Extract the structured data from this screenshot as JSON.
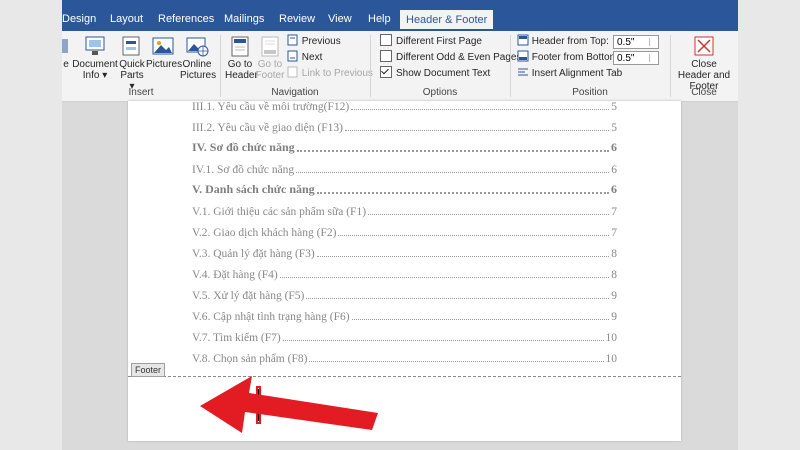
{
  "ribbon_tabs": [
    {
      "label": "Design"
    },
    {
      "label": "Layout"
    },
    {
      "label": "References"
    },
    {
      "label": "Mailings"
    },
    {
      "label": "Review"
    },
    {
      "label": "View"
    },
    {
      "label": "Help"
    },
    {
      "label": "Header & Footer"
    }
  ],
  "insert_group": {
    "label": "Insert",
    "buttons": [
      {
        "label": "e"
      },
      {
        "label": "Document Info ▾"
      },
      {
        "label": "Quick Parts ▾"
      },
      {
        "label": "Pictures"
      },
      {
        "label": "Online Pictures"
      }
    ]
  },
  "navigation_group": {
    "label": "Navigation",
    "go_to_header": "Go to Header",
    "go_to_footer": "Go to Footer",
    "previous": "Previous",
    "next": "Next",
    "link_to_previous": "Link to Previous"
  },
  "options_group": {
    "label": "Options",
    "different_first_page": "Different First Page",
    "different_odd_even": "Different Odd & Even Pages",
    "show_document_text": "Show Document Text",
    "show_document_text_checked": true
  },
  "position_group": {
    "label": "Position",
    "header_from_top_label": "Header from Top:",
    "header_from_top_value": "0.5\"",
    "footer_from_bottom_label": "Footer from Bottom:",
    "footer_from_bottom_value": "0.5\"",
    "insert_alignment_tab": "Insert Alignment Tab"
  },
  "close_group": {
    "label": "Close",
    "close_button": "Close Header and Footer"
  },
  "toc": [
    {
      "text": "III.1. Yêu cầu về môi trường(F12)",
      "page": "5",
      "bold": false
    },
    {
      "text": "III.2. Yêu cầu về giao diện (F13)",
      "page": "5",
      "bold": false
    },
    {
      "text": "IV. Sơ đồ chức năng",
      "page": "6",
      "bold": true
    },
    {
      "text": "IV.1. Sơ đồ chức năng",
      "page": "6",
      "bold": false
    },
    {
      "text": "V. Danh sách chức năng",
      "page": "6",
      "bold": true
    },
    {
      "text": "V.1. Giới thiệu các sản phẩm sữa (F1)",
      "page": "7",
      "bold": false
    },
    {
      "text": "V.2. Giao dịch khách hàng (F2)",
      "page": "7",
      "bold": false
    },
    {
      "text": "V.3. Quản lý đặt hàng (F3)",
      "page": "8",
      "bold": false
    },
    {
      "text": "V.4. Đặt hàng (F4)",
      "page": "8",
      "bold": false
    },
    {
      "text": "V.5. Xử lý đặt hàng (F5)",
      "page": "9",
      "bold": false
    },
    {
      "text": "V.6. Cập nhật tình trạng hàng (F6)",
      "page": "9",
      "bold": false
    },
    {
      "text": "V.7. Tìm kiếm (F7)",
      "page": "10",
      "bold": false
    },
    {
      "text": "V.8. Chọn sản phẩm (F8)",
      "page": "10",
      "bold": false
    }
  ],
  "footer_tag": "Footer",
  "colors": {
    "ribbon_blue": "#2b579a",
    "annotation_red": "#e31b23"
  }
}
